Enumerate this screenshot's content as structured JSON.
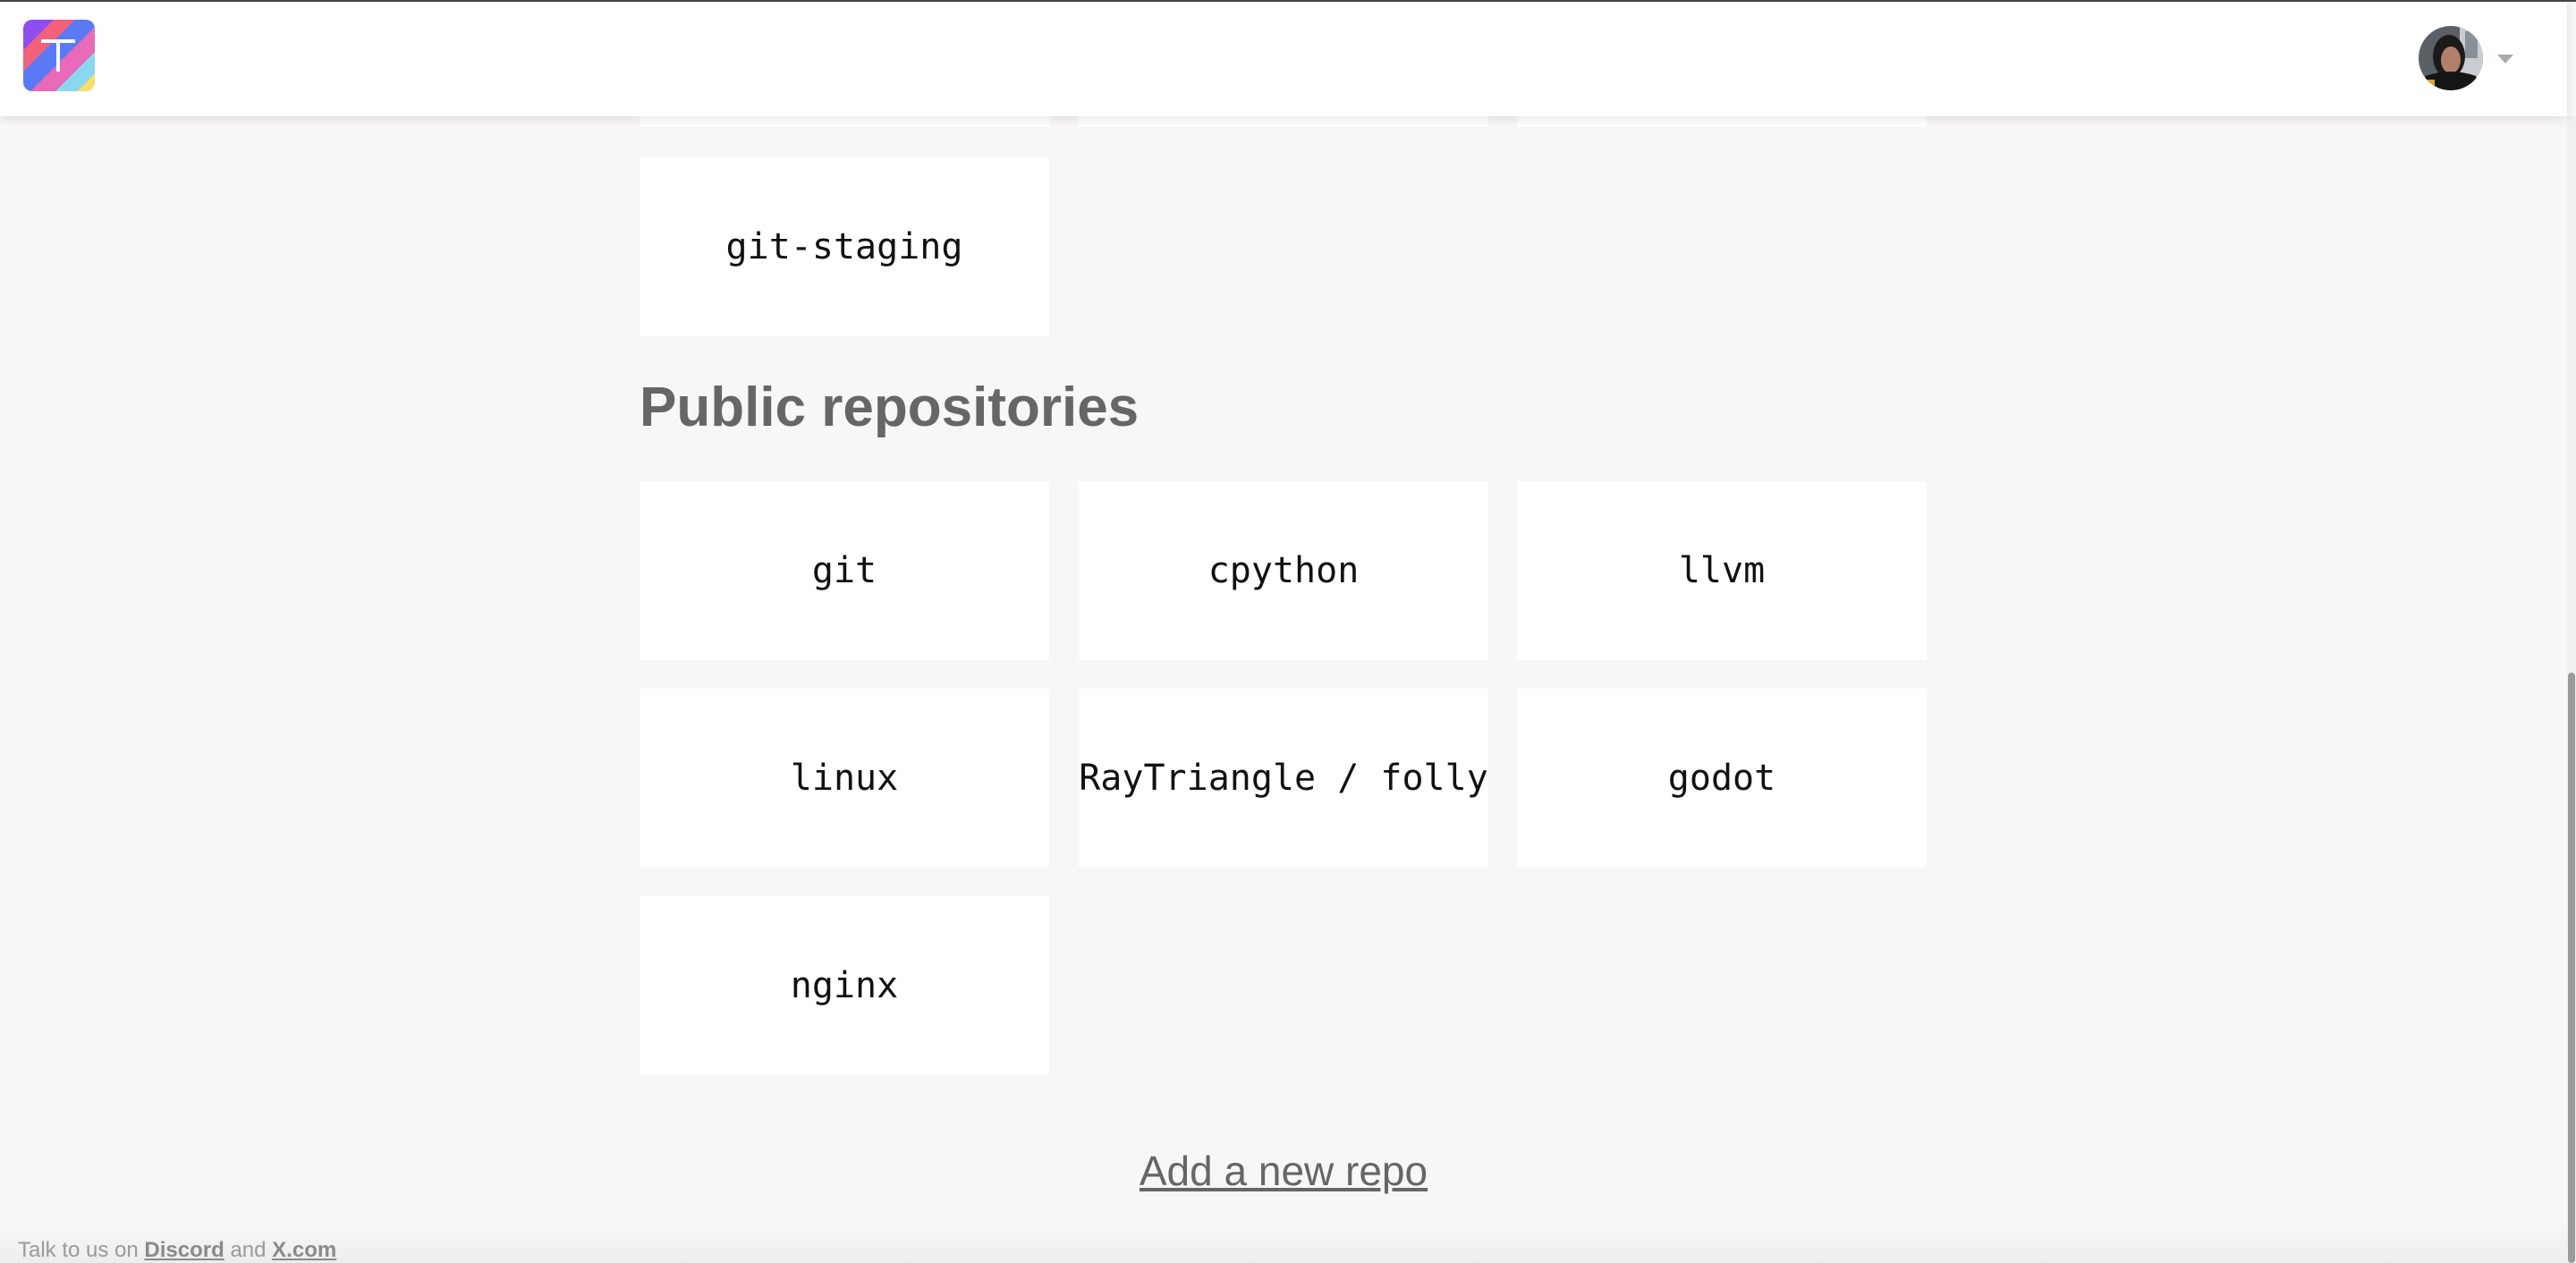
{
  "header": {
    "logo_letter": "T",
    "avatar_alt": "User avatar"
  },
  "private_repos": {
    "partial_cards": [
      "",
      "",
      ""
    ],
    "items": [
      {
        "label": "git-staging"
      }
    ]
  },
  "public_repos": {
    "title": "Public repositories",
    "items": [
      {
        "label": "git"
      },
      {
        "label": "cpython"
      },
      {
        "label": "llvm"
      },
      {
        "label": "linux"
      },
      {
        "label": "RayTriangle / folly"
      },
      {
        "label": "godot"
      },
      {
        "label": "nginx"
      }
    ]
  },
  "actions": {
    "add_repo_label": "Add a new repo"
  },
  "footer": {
    "prefix": "Talk to us on ",
    "discord_label": "Discord",
    "middle": " and ",
    "x_label": "X.com"
  },
  "colors": {
    "background": "#f8f6f6",
    "card": "#ffffff",
    "title": "#666666",
    "footer_text": "#9a9a9a"
  }
}
